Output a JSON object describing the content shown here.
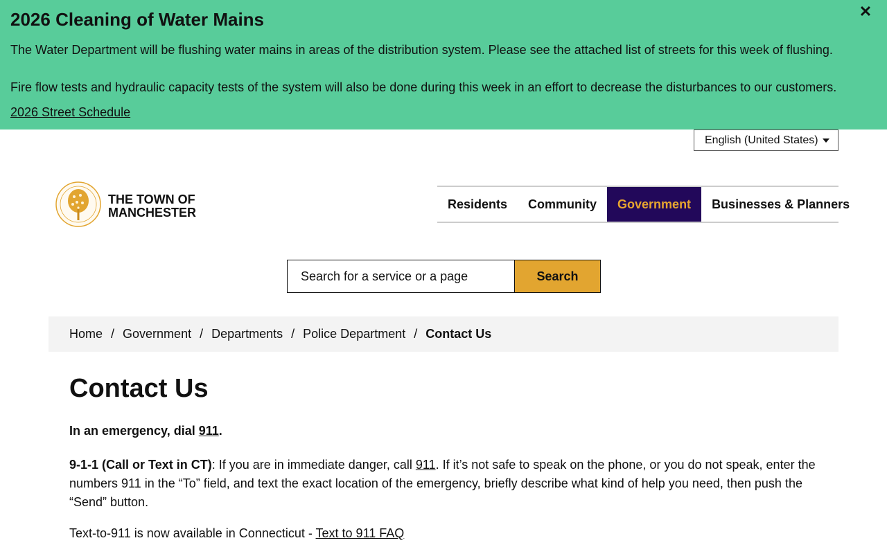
{
  "alert": {
    "title": "2026 Cleaning of Water Mains",
    "close_label": "✕",
    "paragraph1": "The Water Department will be flushing water mains in areas of the distribution system. Please see the attached list of streets for this week of flushing.",
    "paragraph2": "Fire flow tests and hydraulic capacity tests of the system will also be done during this week in an effort to decrease the disturbances to our customers.",
    "link_label": "2026 Street Schedule",
    "color": "#58cc9a"
  },
  "language": {
    "selected": "English (United States)"
  },
  "logo": {
    "line1": "THE TOWN OF",
    "line2": "MANCHESTER",
    "seal_icon": "town-seal-tree-icon",
    "seal_color": "#e2a530"
  },
  "nav": {
    "items": [
      {
        "label": "Residents",
        "active": false
      },
      {
        "label": "Community",
        "active": false
      },
      {
        "label": "Government",
        "active": true
      },
      {
        "label": "Businesses & Planners",
        "active": false
      }
    ],
    "active_bg": "#22085a",
    "active_fg": "#e8a52f"
  },
  "search": {
    "placeholder": "Search for a service or a page",
    "button_label": "Search",
    "button_color": "#e2a530"
  },
  "breadcrumb": {
    "items": [
      "Home",
      "Government",
      "Departments",
      "Police Department",
      "Contact Us"
    ],
    "separator": "/"
  },
  "main": {
    "title": "Contact Us",
    "emergency_prefix": "In an emergency, dial ",
    "emergency_link": "911",
    "emergency_suffix": ".",
    "text911_label": "9-1-1 (Call or Text in CT)",
    "text911_part1": ": If you are in immediate danger, call ",
    "text911_link": "911",
    "text911_part2": ". If it’s not safe to speak on the phone, or you do not speak, enter the numbers 911 in the “To” field, and text the exact location of the emergency, briefly describe what kind of help you need, then push the “Send” button.",
    "text_to_911_prefix": "Text-to-911 is now available in Connecticut - ",
    "text_to_911_link": "Text to 911 FAQ"
  }
}
